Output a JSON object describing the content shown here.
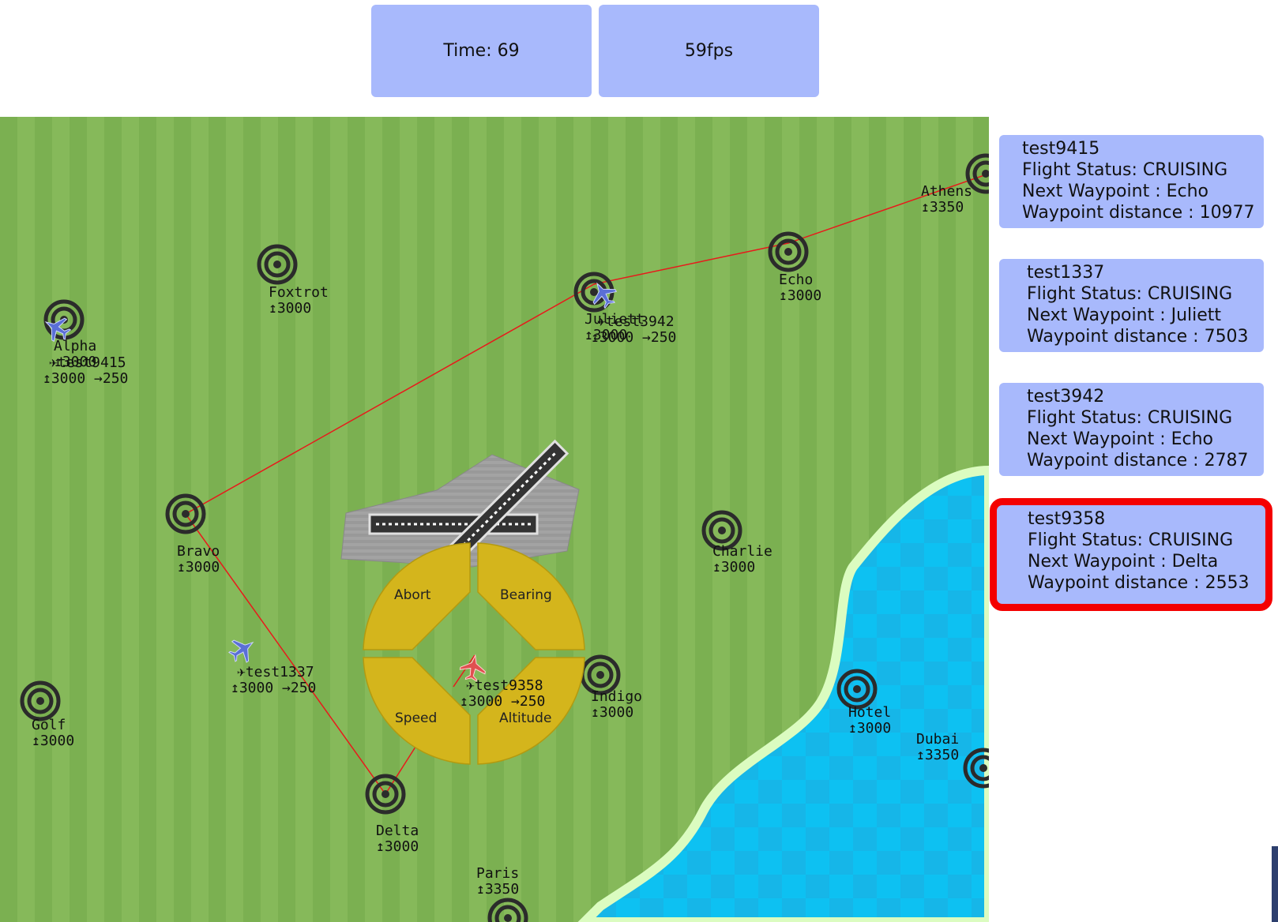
{
  "header": {
    "time_label": "Time:  69",
    "fps_label": "59fps"
  },
  "colors": {
    "grass_light": "#86b95a",
    "grass_dark": "#7bb051",
    "water": "#0dc1f2",
    "shore": "#dbfcc0",
    "route": "#e8191b",
    "panel": "#a8b9fc",
    "selected_border": "#f40000",
    "menu_fill": "#d4b51c",
    "airport_gray": "#9e9e9e"
  },
  "waypoints": [
    {
      "name": "Alpha",
      "altitude": "↥3000"
    },
    {
      "name": "Foxtrot",
      "altitude": "↥3000"
    },
    {
      "name": "Juliett",
      "altitude": "↥3000"
    },
    {
      "name": "Echo",
      "altitude": "↥3000"
    },
    {
      "name": "Athens",
      "altitude": "↥3350"
    },
    {
      "name": "Bravo",
      "altitude": "↥3000"
    },
    {
      "name": "Charlie",
      "altitude": "↥3000"
    },
    {
      "name": "Golf",
      "altitude": "↥3000"
    },
    {
      "name": "Indigo",
      "altitude": "↥3000"
    },
    {
      "name": "Hotel",
      "altitude": "↥3000"
    },
    {
      "name": "Dubai",
      "altitude": "↥3350"
    },
    {
      "name": "Delta",
      "altitude": "↥3000"
    },
    {
      "name": "Paris",
      "altitude": "↥3350"
    }
  ],
  "flight_labels": [
    {
      "callsign": "✈test9415",
      "info": "↥3000 →250"
    },
    {
      "callsign": "✈test3942",
      "info": "↥3000 →250"
    },
    {
      "callsign": "✈test1337",
      "info": "↥3000 →250"
    },
    {
      "callsign": "✈test9358",
      "info": "↥3000 →250"
    }
  ],
  "control_menu": {
    "abort": "Abort",
    "bearing": "Bearing",
    "speed": "Speed",
    "altitude": "Altitude"
  },
  "flights": [
    {
      "id": "test9415",
      "status": "Flight Status: CRUISING",
      "next": "Next Waypoint : Echo",
      "distance": "Waypoint distance : 10977"
    },
    {
      "id": "test1337",
      "status": "Flight Status: CRUISING",
      "next": "Next Waypoint : Juliett",
      "distance": "Waypoint distance : 7503"
    },
    {
      "id": "test3942",
      "status": "Flight Status: CRUISING",
      "next": "Next Waypoint : Echo",
      "distance": "Waypoint distance : 2787"
    },
    {
      "id": "test9358",
      "status": "Flight Status: CRUISING",
      "next": "Next Waypoint : Delta",
      "distance": "Waypoint distance : 2553"
    }
  ]
}
